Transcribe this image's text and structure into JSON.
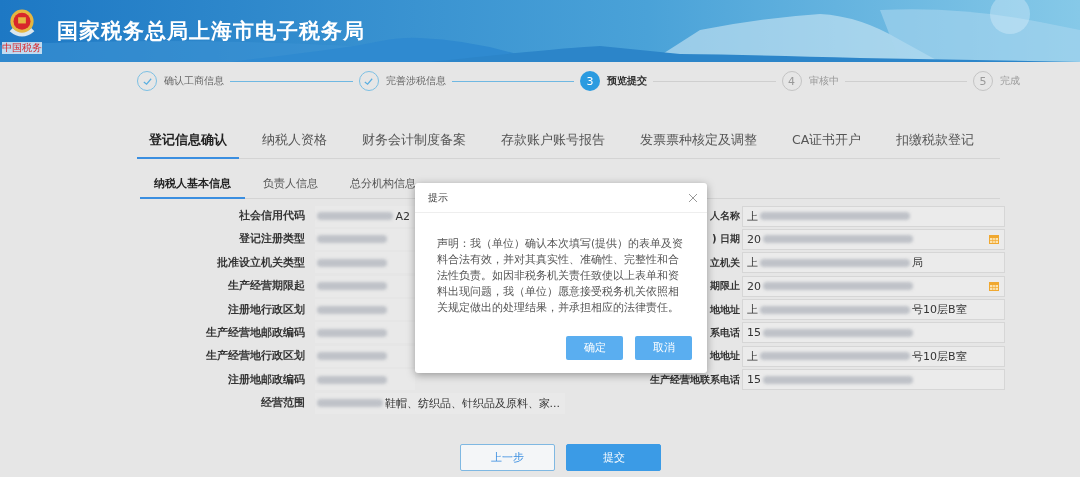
{
  "header": {
    "title": "国家税务总局上海市电子税务局",
    "logo_text": "中国税务"
  },
  "steps": [
    {
      "label": "确认工商信息",
      "completed": true,
      "current": false
    },
    {
      "label": "完善涉税信息",
      "completed": true,
      "current": false
    },
    {
      "number": "3",
      "label": "预览提交",
      "completed": false,
      "current": true
    },
    {
      "number": "4",
      "label": "审核中",
      "completed": false,
      "current": false
    },
    {
      "number": "5",
      "label": "完成",
      "completed": false,
      "current": false
    }
  ],
  "tabs": [
    {
      "label": "登记信息确认",
      "selected": true
    },
    {
      "label": "纳税人资格",
      "selected": false
    },
    {
      "label": "财务会计制度备案",
      "selected": false
    },
    {
      "label": "存款账户账号报告",
      "selected": false
    },
    {
      "label": "发票票种核定及调整",
      "selected": false
    },
    {
      "label": "CA证书开户",
      "selected": false
    },
    {
      "label": "扣缴税款登记",
      "selected": false
    }
  ],
  "subtabs": [
    {
      "label": "纳税人基本信息",
      "selected": true
    },
    {
      "label": "负责人信息",
      "selected": false
    },
    {
      "label": "总分机构信息",
      "selected": false
    }
  ],
  "left_fields": [
    {
      "label": "社会信用代码",
      "blurred": true,
      "value_end": "A2"
    },
    {
      "label": "登记注册类型",
      "blurred": true
    },
    {
      "label": "批准设立机关类型",
      "blurred": true
    },
    {
      "label": "生产经营期限起",
      "blurred": true
    },
    {
      "label": "注册地行政区划",
      "blurred": true
    },
    {
      "label": "生产经营地邮政编码",
      "blurred": true
    },
    {
      "label": "生产经营地行政区划",
      "blurred": true
    },
    {
      "label": "注册地邮政编码",
      "blurred": true
    },
    {
      "label": "经营范围",
      "blurred": true,
      "value_end": "鞋帽、纺织品、针织品及原料、家..."
    }
  ],
  "right_fields": [
    {
      "label": "人名称",
      "date_picker": false,
      "blurred": true,
      "value_start": "上"
    },
    {
      "label": ") 日期",
      "date_picker": true,
      "blurred": true,
      "value_start": "20"
    },
    {
      "label": "立机关",
      "date_picker": false,
      "blurred": true,
      "value_start": "上",
      "value_end": "局"
    },
    {
      "label": "期限止",
      "date_picker": true,
      "blurred": true,
      "value_start": "20"
    },
    {
      "label": "地地址",
      "date_picker": false,
      "blurred": true,
      "value_start": "上",
      "value_end": "号10层B室"
    },
    {
      "label": "系电话",
      "date_picker": false,
      "blurred": true,
      "value_start": "15"
    },
    {
      "label": "地地址",
      "date_picker": false,
      "blurred": true,
      "value_start": "上",
      "value_end": "号10层B室"
    },
    {
      "label": "生产经营地联系电话",
      "date_picker": false,
      "blurred": true,
      "value_start": "15"
    }
  ],
  "dialog": {
    "title": "提示",
    "message": "声明：我（单位）确认本次填写(提供）的表单及资料合法有效，并对其真实性、准确性、完整性和合法性负责。如因非税务机关责任致使以上表单和资料出现问题，我（单位）愿意接受税务机关依照相关规定做出的处理结果，并承担相应的法律责任。",
    "buttons": [
      "确定",
      "取消"
    ]
  },
  "footer_buttons": [
    {
      "label": "上一步",
      "kind": "secondary"
    },
    {
      "label": "提交",
      "kind": "primary"
    }
  ]
}
